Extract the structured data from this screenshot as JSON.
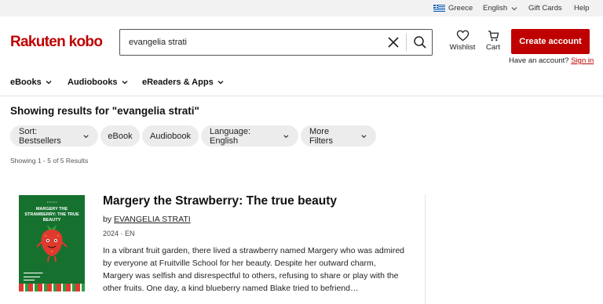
{
  "topbar": {
    "country": "Greece",
    "language": "English",
    "gift_cards": "Gift Cards",
    "help": "Help"
  },
  "header": {
    "logo": "Rakuten kobo",
    "search_value": "evangelia strati",
    "wishlist": "Wishlist",
    "cart": "Cart",
    "create_account": "Create account",
    "have_account": "Have an account?",
    "sign_in": "Sign in"
  },
  "nav": {
    "items": [
      "eBooks",
      "Audiobooks",
      "eReaders & Apps"
    ]
  },
  "results": {
    "heading": "Showing results for \"evangelia strati\"",
    "count": "Showing 1 - 5 of 5 Results"
  },
  "filters": {
    "sort": "Sort: Bestsellers",
    "ebook": "eBook",
    "audiobook": "Audiobook",
    "language": "Language: English",
    "more": "More Filters"
  },
  "book": {
    "title": "Margery the Strawberry: The true beauty",
    "by": "by",
    "author": "EVANGELIA STRATI",
    "meta": "2024 · EN",
    "description": "In a vibrant fruit garden, there lived a strawberry named Margery who was admired by everyone at Fruitville School for her beauty. Despite her outward charm, Margery was selfish and disrespectful to others, refusing to share or play with the other fruits. One day, a kind blueberry named Blake tried to befriend…",
    "cover_title": "MARGERY THE STRAWBERRY: THE TRUE BEAUTY"
  },
  "colors": {
    "brand": "#bf0000",
    "cover_green": "#16712f"
  }
}
